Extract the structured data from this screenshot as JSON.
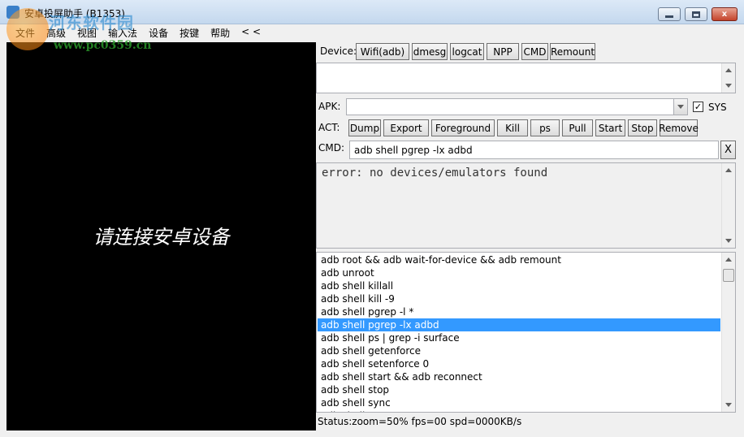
{
  "window": {
    "title": "安卓投屏助手 (B1353)",
    "minimize_label": "",
    "close_label": "x"
  },
  "watermark": {
    "name": "河东软件园",
    "url": "www.pc0359.cn"
  },
  "menu": [
    {
      "label": "文件"
    },
    {
      "label": "高级"
    },
    {
      "label": "视图"
    },
    {
      "label": "输入法"
    },
    {
      "label": "设备"
    },
    {
      "label": "按键"
    },
    {
      "label": "帮助"
    },
    {
      "label": "< <"
    }
  ],
  "screen": {
    "message": "请连接安卓设备"
  },
  "device": {
    "label": "Device:",
    "buttons": [
      "Wifi(adb)",
      "dmesg",
      "logcat",
      "NPP",
      "CMD",
      "Remount"
    ]
  },
  "apk": {
    "label": "APK:",
    "value": "",
    "sys_label": "SYS",
    "sys_checked": "✓"
  },
  "act": {
    "label": "ACT:",
    "buttons": [
      "Dump",
      "Export",
      "Foreground",
      "Kill",
      "ps",
      "Pull",
      "Start",
      "Stop",
      "Remove"
    ]
  },
  "cmd": {
    "label": "CMD:",
    "value": "adb shell pgrep -lx adbd",
    "clear_label": "X"
  },
  "output": {
    "text": "error: no devices/emulators found"
  },
  "commands": {
    "selected_index": 5,
    "items": [
      "adb root && adb wait-for-device && adb remount",
      "adb unroot",
      "adb shell killall",
      "adb shell kill -9",
      "adb shell pgrep -l *",
      "adb shell pgrep -lx adbd",
      "adb shell ps | grep -i surface",
      "adb shell getenforce",
      "adb shell setenforce 0",
      "adb shell start && adb reconnect",
      "adb shell stop",
      "adb shell sync",
      "adb shell uname -a"
    ]
  },
  "status": {
    "text": "Status:zoom=50% fps=00 spd=0000KB/s"
  }
}
